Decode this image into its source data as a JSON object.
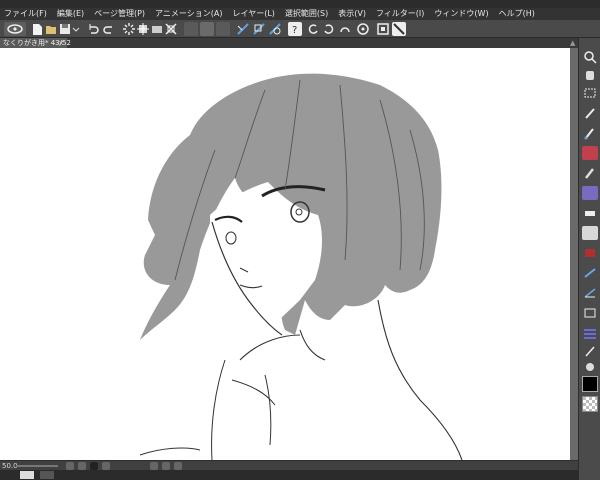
{
  "menu": [
    "ファイル(F)",
    "編集(E)",
    "ページ管理(P)",
    "アニメーション(A)",
    "レイヤー(L)",
    "選択範囲(S)",
    "表示(V)",
    "フィルター(I)",
    "ウィンドウ(W)",
    "ヘルプ(H)"
  ],
  "tab": {
    "label": "なくりがき用* 43/52",
    "close": "×"
  },
  "status": {
    "zoom": "50.0"
  },
  "colors": {
    "main": "#000000",
    "accent": "#4a88c8",
    "hair": "#9a9a9a"
  },
  "icons": {
    "toolbar": [
      "clip-studio-icon",
      "new-file-icon",
      "open-file-icon",
      "save-icon",
      "undo-icon",
      "redo-icon",
      "loading-icon",
      "move-icon",
      "transform-icon",
      "snap-ruler-icon",
      "snap-grid-icon",
      "snap-special-icon",
      "help-icon",
      "rotate-left-icon",
      "rotate-right-icon",
      "flip-icon",
      "frame-icon",
      "ruler-icon"
    ],
    "sidebar": [
      "zoom-icon",
      "move-icon",
      "selection-icon",
      "eyedropper-icon",
      "pen-icon",
      "pencil-icon",
      "brush-icon",
      "airbrush-icon",
      "decoration-icon",
      "eraser-icon",
      "fill-icon",
      "gradient-icon",
      "figure-icon",
      "frame-border-icon",
      "ruler-tool-icon",
      "text-icon",
      "balloon-icon",
      "line-correct-icon",
      "correction-icon",
      "blend-icon"
    ]
  }
}
